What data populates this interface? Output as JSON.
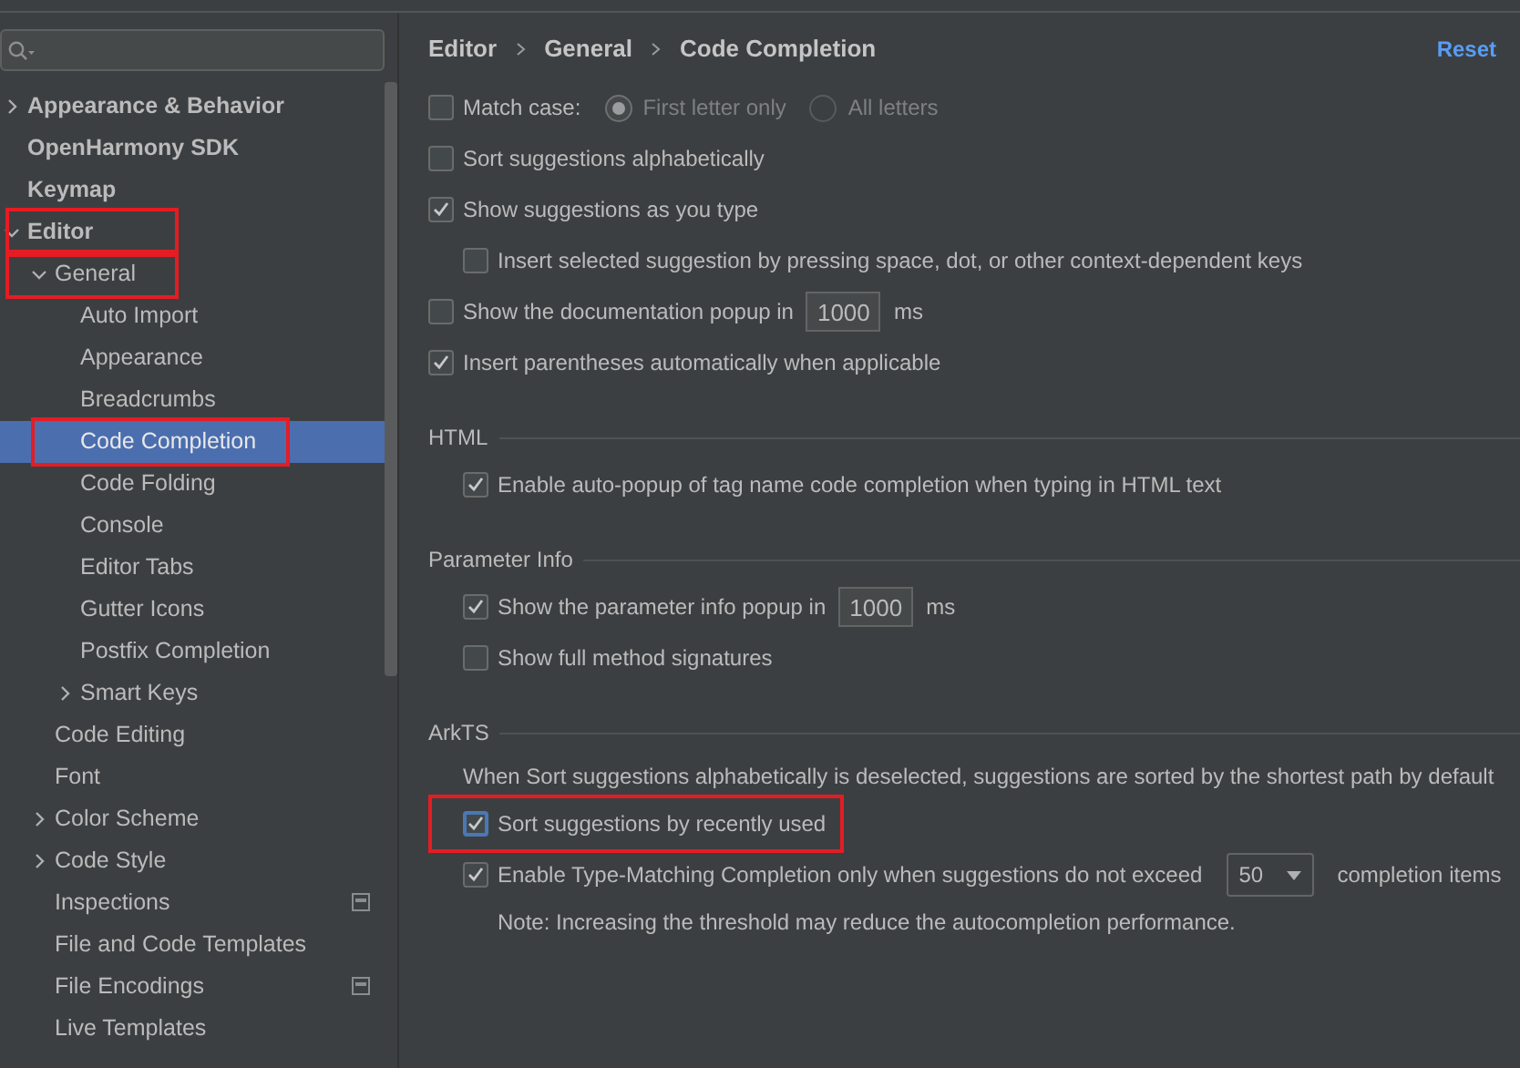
{
  "sidebar": {
    "tree": [
      {
        "label": "Appearance & Behavior",
        "bold": true,
        "expanded": false,
        "has_children": true,
        "selected": false
      },
      {
        "label": "OpenHarmony SDK",
        "bold": true,
        "selected": false
      },
      {
        "label": "Keymap",
        "bold": true,
        "selected": false
      },
      {
        "label": "Editor",
        "bold": true,
        "expanded": true,
        "has_children": true,
        "selected": false,
        "annotated": true,
        "children": [
          {
            "label": "General",
            "expanded": true,
            "has_children": true,
            "selected": false,
            "annotated": true,
            "children": [
              {
                "label": "Auto Import",
                "selected": false
              },
              {
                "label": "Appearance",
                "selected": false
              },
              {
                "label": "Breadcrumbs",
                "selected": false
              },
              {
                "label": "Code Completion",
                "selected": true,
                "annotated": true
              },
              {
                "label": "Code Folding",
                "selected": false
              },
              {
                "label": "Console",
                "selected": false
              },
              {
                "label": "Editor Tabs",
                "selected": false
              },
              {
                "label": "Gutter Icons",
                "selected": false
              },
              {
                "label": "Postfix Completion",
                "selected": false
              },
              {
                "label": "Smart Keys",
                "expanded": false,
                "has_children": true,
                "selected": false
              }
            ]
          },
          {
            "label": "Code Editing",
            "selected": false
          },
          {
            "label": "Font",
            "selected": false
          },
          {
            "label": "Color Scheme",
            "expanded": false,
            "has_children": true,
            "selected": false
          },
          {
            "label": "Code Style",
            "expanded": false,
            "has_children": true,
            "selected": false
          },
          {
            "label": "Inspections",
            "selected": false,
            "project_badge": true
          },
          {
            "label": "File and Code Templates",
            "selected": false
          },
          {
            "label": "File Encodings",
            "selected": false,
            "project_badge": true
          },
          {
            "label": "Live Templates",
            "selected": false
          }
        ]
      }
    ]
  },
  "breadcrumb": [
    "Editor",
    "General",
    "Code Completion"
  ],
  "reset": "Reset",
  "options": [
    {
      "kind": "match_case",
      "label": "Match case:",
      "checked": false,
      "radios": [
        {
          "label": "First letter only",
          "selected": true
        },
        {
          "label": "All letters",
          "selected": false
        }
      ]
    },
    {
      "kind": "checkbox",
      "label": "Sort suggestions alphabetically",
      "checked": false
    },
    {
      "kind": "checkbox",
      "label": "Show suggestions as you type",
      "checked": true,
      "children": [
        {
          "kind": "checkbox",
          "label": "Insert selected suggestion by pressing space, dot, or other context-dependent keys",
          "checked": false
        }
      ]
    },
    {
      "kind": "checkbox_input",
      "label": "Show the documentation popup in",
      "checked": false,
      "value": "1000",
      "unit": "ms"
    },
    {
      "kind": "checkbox",
      "label": "Insert parentheses automatically when applicable",
      "checked": true
    }
  ],
  "sections": [
    {
      "title": "HTML",
      "options": [
        {
          "kind": "checkbox",
          "label": "Enable auto-popup of tag name code completion when typing in HTML text",
          "checked": true
        }
      ]
    },
    {
      "title": "Parameter Info",
      "options": [
        {
          "kind": "checkbox_input",
          "label": "Show the parameter info popup in",
          "checked": true,
          "value": "1000",
          "unit": "ms"
        },
        {
          "kind": "checkbox",
          "label": "Show full method signatures",
          "checked": false
        }
      ]
    },
    {
      "title": "ArkTS",
      "options": [
        {
          "kind": "note",
          "label": "When Sort suggestions alphabetically is deselected, suggestions are sorted by the shortest path by default"
        },
        {
          "kind": "checkbox",
          "label": "Sort suggestions by recently used",
          "checked": true,
          "focused": true,
          "annotated": true
        },
        {
          "kind": "checkbox_dropdown",
          "label": "Enable Type-Matching Completion only when suggestions do not exceed",
          "checked": true,
          "value": "50",
          "unit": "completion items",
          "children": [
            {
              "kind": "note",
              "label": "Note: Increasing the threshold may reduce the autocompletion performance."
            }
          ]
        }
      ]
    }
  ]
}
